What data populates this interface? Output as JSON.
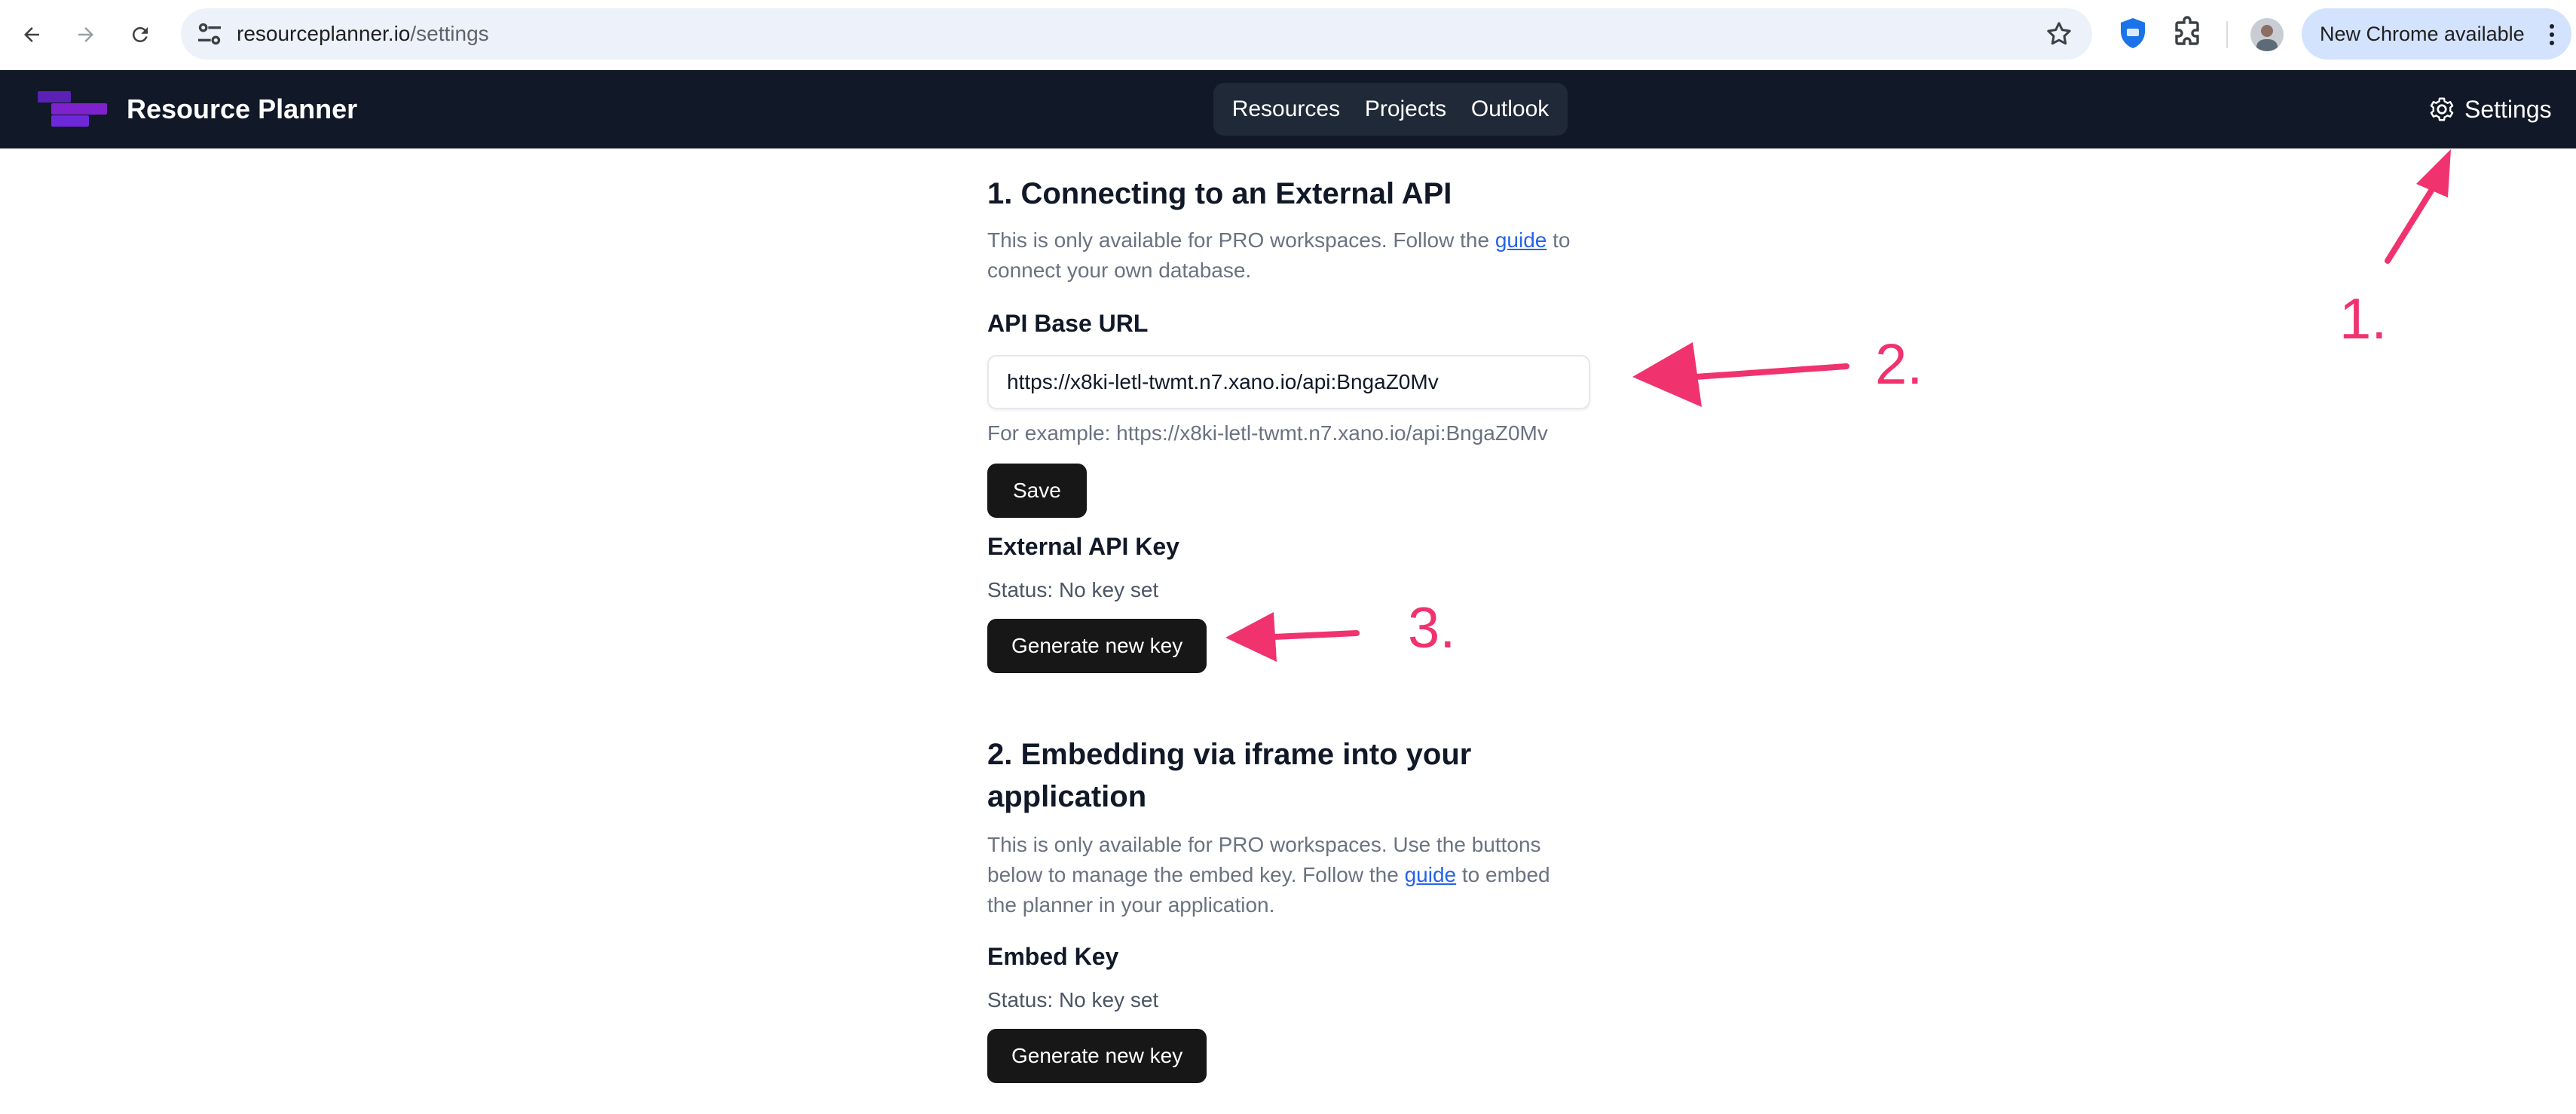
{
  "browser": {
    "url_host": "resourceplanner.io",
    "url_path": "/settings",
    "update_label": "New Chrome available"
  },
  "app": {
    "brand": "Resource Planner",
    "tabs": [
      "Resources",
      "Projects",
      "Outlook"
    ],
    "settings_label": "Settings"
  },
  "section1": {
    "title": "1. Connecting to an External API",
    "desc_before": "This is only available for PRO workspaces. Follow the ",
    "desc_link": "guide",
    "desc_after": " to connect your own database.",
    "api_url_label": "API Base URL",
    "api_url_value": "https://x8ki-letl-twmt.n7.xano.io/api:BngaZ0Mv",
    "api_url_hint": "For example: https://x8ki-letl-twmt.n7.xano.io/api:BngaZ0Mv",
    "save_label": "Save",
    "key_label": "External API Key",
    "key_status": "Status: No key set",
    "generate_label": "Generate new key"
  },
  "section2": {
    "title": "2. Embedding via iframe into your application",
    "desc_before": "This is only available for PRO workspaces. Use the buttons below to manage the embed key. Follow the ",
    "desc_link": "guide",
    "desc_after": " to embed the planner in your application.",
    "key_label": "Embed Key",
    "key_status": "Status: No key set",
    "generate_label": "Generate new key"
  },
  "annotations": [
    "1.",
    "2.",
    "3."
  ],
  "colors": {
    "header_bg": "#111827",
    "accent_purple": "#7e22ce",
    "annotation": "#f0336e",
    "link": "#2563eb"
  }
}
